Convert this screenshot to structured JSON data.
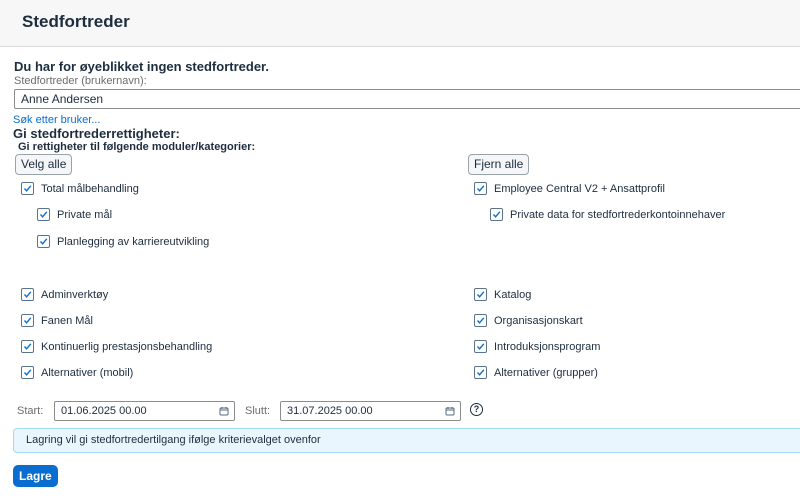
{
  "header": {
    "title": "Stedfortreder"
  },
  "status_heading": "Du har for øyeblikket ingen stedfortreder.",
  "user_field": {
    "label": "Stedfortreder (brukernavn):",
    "value": "Anne Andersen"
  },
  "search_link": "Søk etter bruker...",
  "rights": {
    "heading": "Gi stedfortrederrettigheter:",
    "subheading": "Gi rettigheter til følgende moduler/kategorier:",
    "select_all": "Velg alle",
    "remove_all": "Fjern alle"
  },
  "checkboxes": {
    "total_goal": "Total målbehandling",
    "private_goals": "Private mål",
    "career_planning": "Planlegging av karriereutvikling",
    "employee_central": "Employee Central V2 + Ansattprofil",
    "private_data": "Private data for stedfortrederkontoinnehaver",
    "admin_tools": "Adminverktøy",
    "goals_tab": "Fanen Mål",
    "continuous_performance": "Kontinuerlig prestasjonsbehandling",
    "alternatives_mobile": "Alternativer (mobil)",
    "catalog": "Katalog",
    "org_chart": "Organisasjonskart",
    "onboarding": "Introduksjonsprogram",
    "alternatives_groups": "Alternativer (grupper)"
  },
  "dates": {
    "start_label": "Start:",
    "start_value": "01.06.2025 00.00",
    "end_label": "Slutt:",
    "end_value": "31.07.2025 00.00",
    "help_icon": "?"
  },
  "info_message": "Lagring vil gi stedfortredertilgang ifølge kriterievalget ovenfor",
  "save_label": "Lagre",
  "colors": {
    "accent": "#0a6ed1",
    "info_bg": "#eaf6fd"
  }
}
